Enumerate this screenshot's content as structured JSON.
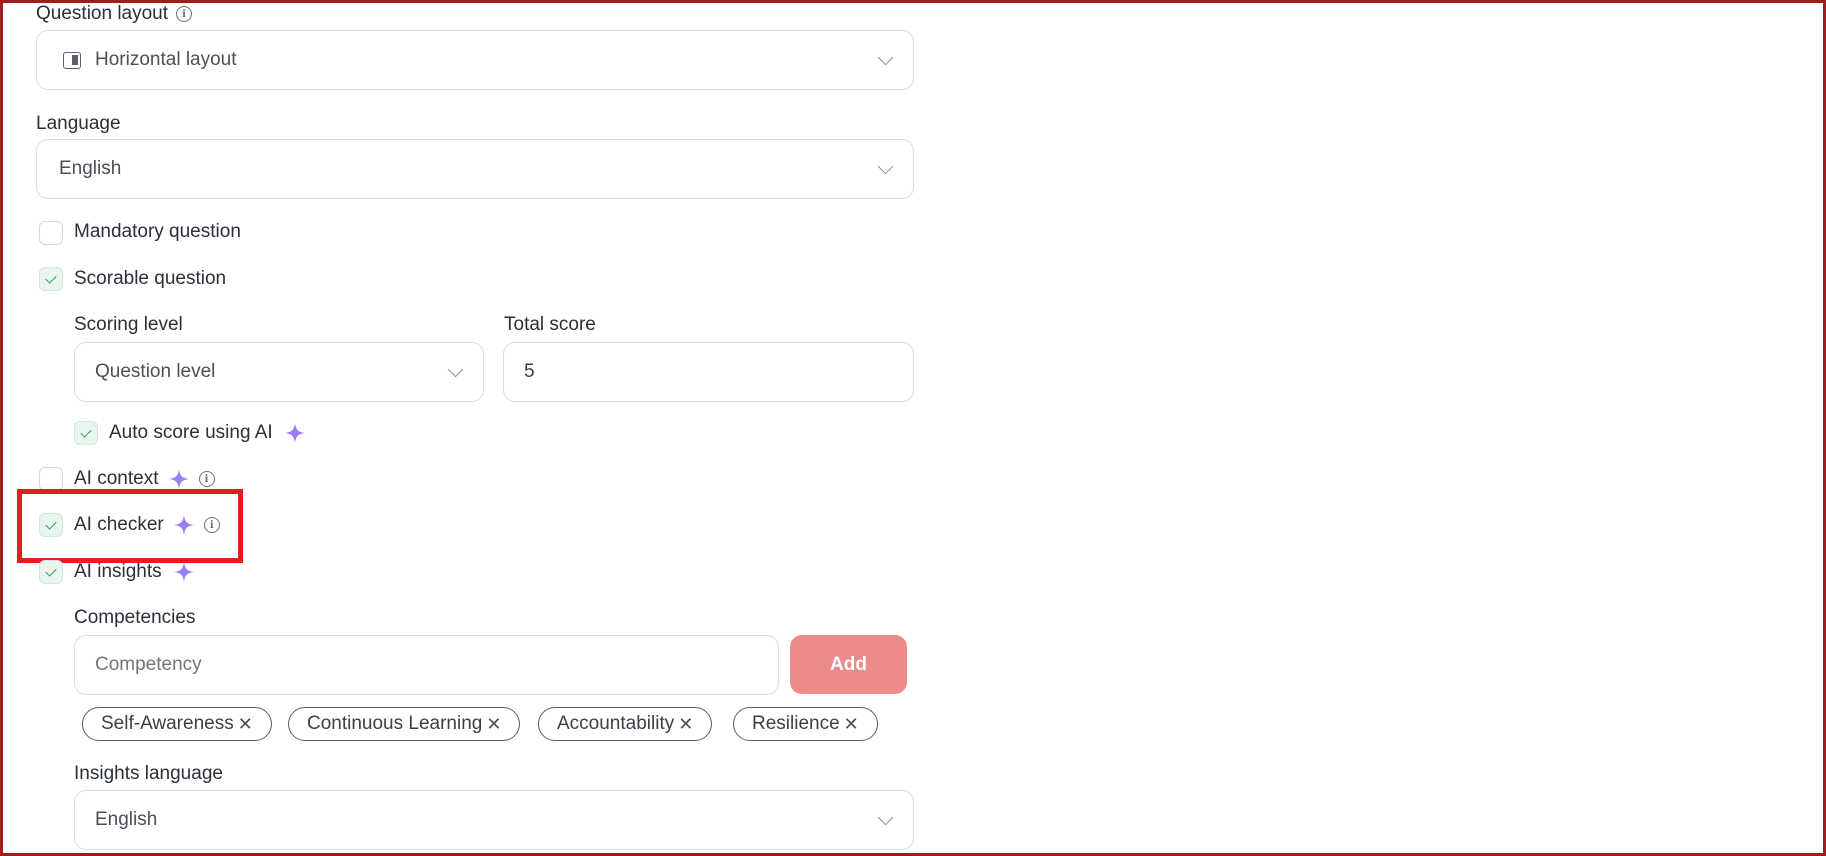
{
  "question_layout": {
    "label": "Question layout",
    "value": "Horizontal layout",
    "icon": "layout-icon"
  },
  "language": {
    "label": "Language",
    "value": "English"
  },
  "mandatory": {
    "label": "Mandatory question",
    "checked": false
  },
  "scorable": {
    "label": "Scorable question",
    "checked": true
  },
  "scoring_level": {
    "label": "Scoring level",
    "value": "Question level"
  },
  "total_score": {
    "label": "Total score",
    "value": "5"
  },
  "auto_score": {
    "label": "Auto score using AI",
    "checked": true
  },
  "ai_context": {
    "label": "AI context",
    "checked": false
  },
  "ai_checker": {
    "label": "AI checker",
    "checked": true
  },
  "ai_insights": {
    "label": "AI insights",
    "checked": true
  },
  "competencies": {
    "label": "Competencies",
    "placeholder": "Competency",
    "add_label": "Add",
    "chips": [
      "Self-Awareness",
      "Continuous Learning",
      "Accountability",
      "Resilience"
    ]
  },
  "insights_language": {
    "label": "Insights language",
    "value": "English"
  },
  "colors": {
    "accent": "#ec8a8c",
    "sparkle": "#9b7cf2",
    "highlight": "#e0201f",
    "check": "#2c9a5d"
  }
}
